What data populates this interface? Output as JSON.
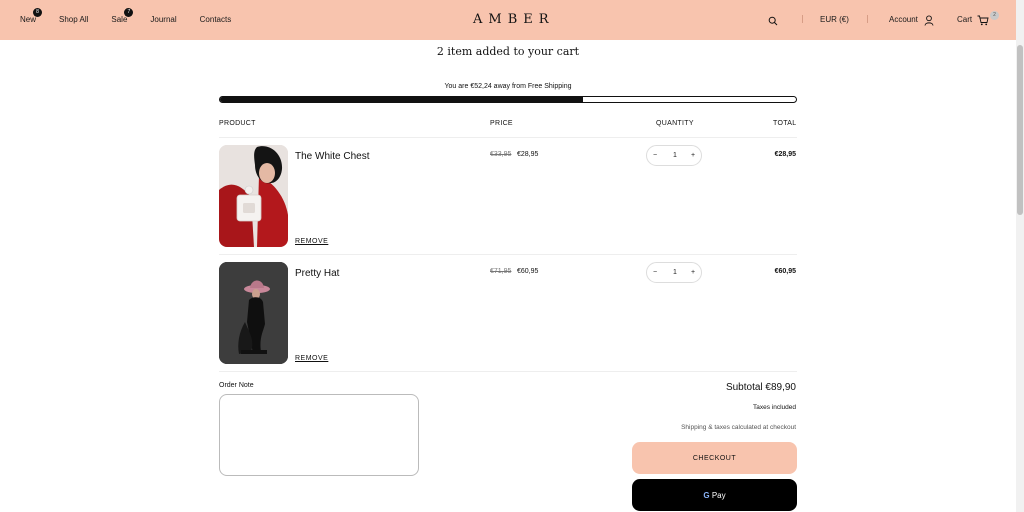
{
  "header": {
    "nav": [
      {
        "label": "New",
        "badge": "8"
      },
      {
        "label": "Shop All",
        "badge": ""
      },
      {
        "label": "Sale",
        "badge": "7"
      },
      {
        "label": "Journal",
        "badge": ""
      },
      {
        "label": "Contacts",
        "badge": ""
      }
    ],
    "logo": "AMBER",
    "currency": "EUR (€)",
    "account": "Account",
    "cart": "Cart",
    "cart_count": "2",
    "background_color": "#f8c4ae"
  },
  "cart": {
    "title": "2 item added to your cart",
    "shipping_message": "You are €52,24 away from Free Shipping",
    "shipping_progress_percent": 63,
    "columns": {
      "product": "PRODUCT",
      "price": "PRICE",
      "quantity": "QUANTITY",
      "total": "TOTAL"
    },
    "items": [
      {
        "name": "The White Chest",
        "old_price": "€33,95",
        "price": "€28,95",
        "quantity": "1",
        "total": "€28,95",
        "remove": "REMOVE"
      },
      {
        "name": "Pretty Hat",
        "old_price": "€71,95",
        "price": "€60,95",
        "quantity": "1",
        "total": "€60,95",
        "remove": "REMOVE"
      }
    ],
    "qty_minus": "−",
    "qty_plus": "+"
  },
  "summary": {
    "order_note_label": "Order Note",
    "subtotal": "Subtotal €89,90",
    "taxes": "Taxes included",
    "shipping_note": "Shipping & taxes calculated at checkout",
    "checkout_label": "CHECKOUT",
    "gpay_g": "G",
    "gpay_label": "Pay",
    "accent_color": "#f8c4ae"
  }
}
